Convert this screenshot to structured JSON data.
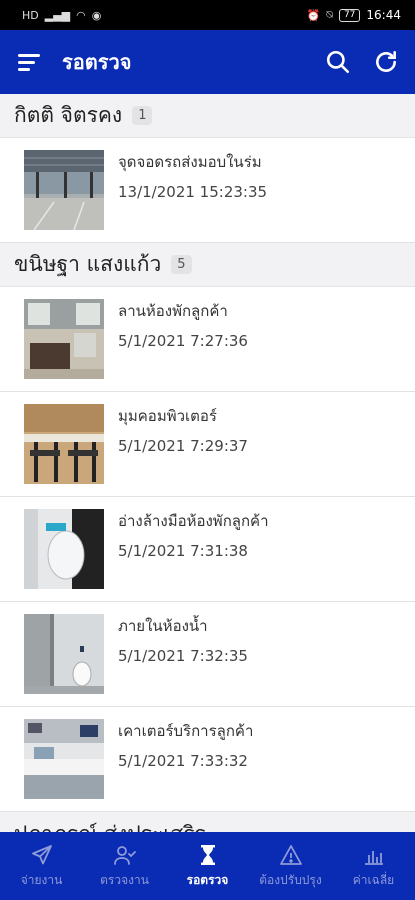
{
  "status_bar": {
    "left_icons": [
      "hd-icon",
      "signal-icon",
      "wifi-icon",
      "messenger-icon"
    ],
    "battery": "77",
    "time": "16:44"
  },
  "app_bar": {
    "title": "รอตรวจ",
    "actions": [
      "search-icon",
      "refresh-icon"
    ]
  },
  "groups": [
    {
      "name": "กิตติ จิตรคง",
      "count": "1",
      "items": [
        {
          "title": "จุดจอดรถส่งมอบในร่ม",
          "date": "13/1/2021 15:23:35",
          "thumb": "parking"
        }
      ]
    },
    {
      "name": "ขนิษฐา แสงแก้ว",
      "count": "5",
      "items": [
        {
          "title": "ลานห้องพักลูกค้า",
          "date": "5/1/2021 7:27:36",
          "thumb": "lounge"
        },
        {
          "title": "มุมคอมพิวเตอร์",
          "date": "5/1/2021 7:29:37",
          "thumb": "computer"
        },
        {
          "title": "อ่างล้างมือห้องพักลูกค้า",
          "date": "5/1/2021 7:31:38",
          "thumb": "sink"
        },
        {
          "title": "ภายในห้องน้ำ",
          "date": "5/1/2021 7:32:35",
          "thumb": "toilet"
        },
        {
          "title": "เคาเตอร์บริการลูกค้า",
          "date": "5/1/2021 7:33:32",
          "thumb": "counter"
        }
      ]
    },
    {
      "name": "ปภาภรณ์ ส่งประเสริฐ",
      "count": "",
      "items": []
    }
  ],
  "bottom_nav": [
    {
      "label": "จ่ายงาน",
      "icon": "send-icon",
      "active": false
    },
    {
      "label": "ตรวจงาน",
      "icon": "user-check-icon",
      "active": false
    },
    {
      "label": "รอตรวจ",
      "icon": "hourglass-icon",
      "active": true
    },
    {
      "label": "ต้องปรับปรุง",
      "icon": "warning-icon",
      "active": false
    },
    {
      "label": "ค่าเฉลี่ย",
      "icon": "bar-chart-icon",
      "active": false
    }
  ],
  "colors": {
    "primary": "#0a2bb3",
    "nav_inactive": "#8f9bd9",
    "background": "#f2f2f4"
  }
}
